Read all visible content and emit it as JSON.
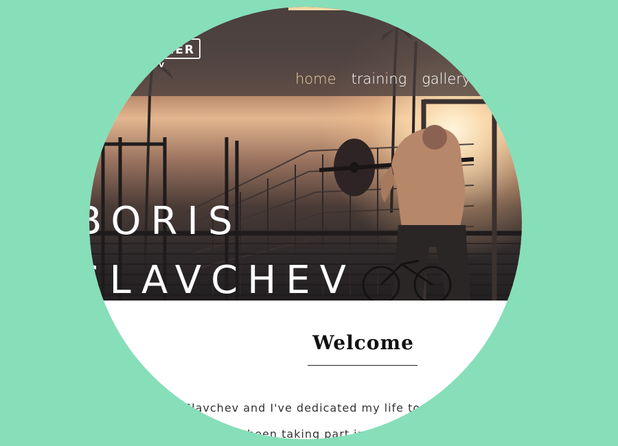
{
  "brand": {
    "logo_text": "NER",
    "logo_sub": "HEV"
  },
  "nav": {
    "items": [
      {
        "label": "home",
        "active": true
      },
      {
        "label": "training",
        "active": false
      },
      {
        "label": "gallery",
        "active": false
      }
    ]
  },
  "hero": {
    "title_line1": "BORIS",
    "title_line2": "SLAVCHEV"
  },
  "welcome": {
    "heading": "Welcome",
    "intro_line1": "Slavchev and I've dedicated my life to h",
    "intro_line2": "been taking part in l"
  },
  "colors": {
    "page_background": "#86dfb9",
    "nav_active": "#e9cfa2",
    "accent_bar": "#efd9a7"
  }
}
